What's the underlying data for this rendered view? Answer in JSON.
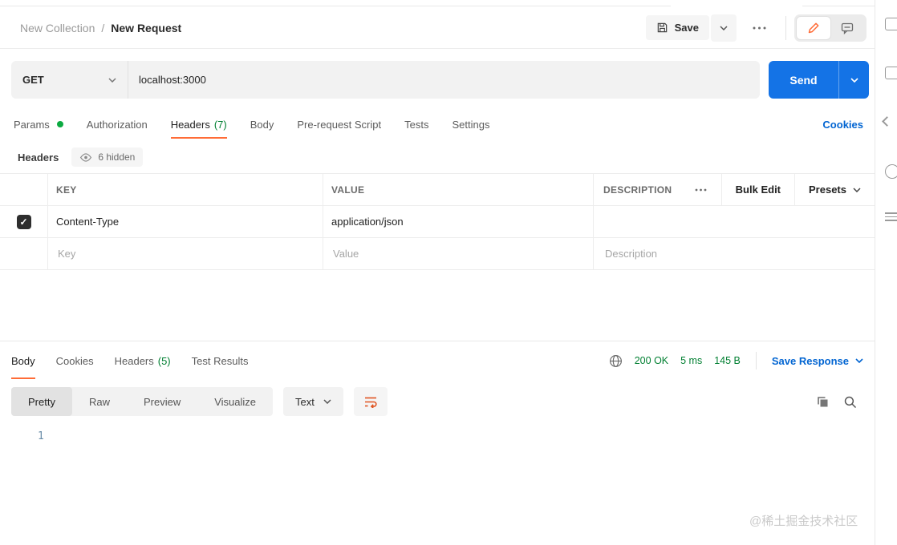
{
  "colors": {
    "accent_orange": "#ff6c37",
    "success_green_text": "#007f31",
    "success_green_dot": "#0caa41",
    "link_blue": "#0265d2",
    "send_blue": "#1473e6"
  },
  "topbar": {
    "breadcrumb": {
      "parent": "New Collection",
      "separator": "/",
      "current": "New Request"
    },
    "save_label": "Save"
  },
  "request_bar": {
    "method": "GET",
    "url": "localhost:3000",
    "send_label": "Send"
  },
  "request_tabs": {
    "items": [
      {
        "label": "Params"
      },
      {
        "label": "Authorization"
      },
      {
        "label": "Headers",
        "count": "(7)"
      },
      {
        "label": "Body"
      },
      {
        "label": "Pre-request Script"
      },
      {
        "label": "Tests"
      },
      {
        "label": "Settings"
      }
    ],
    "cookies_link": "Cookies"
  },
  "headers_editor": {
    "title": "Headers",
    "hidden_badge": "6 hidden",
    "columns": {
      "key": "KEY",
      "value": "VALUE",
      "description": "DESCRIPTION"
    },
    "bulk_edit_label": "Bulk Edit",
    "presets_label": "Presets",
    "rows": [
      {
        "key": "Content-Type",
        "value": "application/json",
        "description": ""
      }
    ],
    "placeholders": {
      "key": "Key",
      "value": "Value",
      "description": "Description"
    }
  },
  "response": {
    "tabs": [
      {
        "label": "Body"
      },
      {
        "label": "Cookies"
      },
      {
        "label": "Headers",
        "count": "(5)"
      },
      {
        "label": "Test Results"
      }
    ],
    "status": "200 OK",
    "time": "5 ms",
    "size": "145 B",
    "save_response_label": "Save Response",
    "view_modes": [
      "Pretty",
      "Raw",
      "Preview",
      "Visualize"
    ],
    "format_select": "Text",
    "editor": {
      "line_number": "1"
    }
  },
  "watermark": "@稀土掘金技术社区"
}
